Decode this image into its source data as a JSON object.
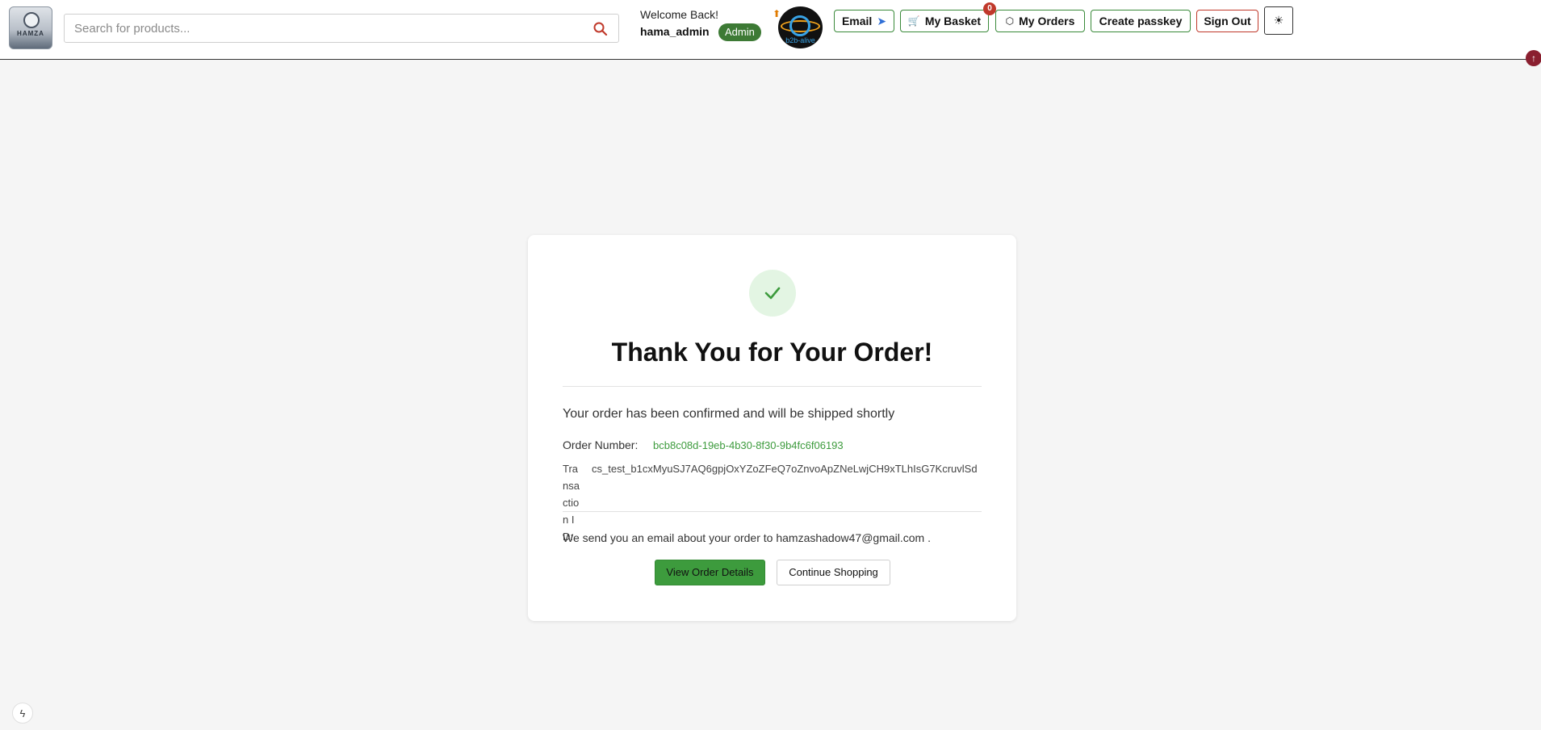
{
  "header": {
    "logo_text": "HAMZA",
    "search_placeholder": "Search for products...",
    "welcome": "Welcome Back!",
    "username": "hama_admin",
    "role": "Admin",
    "brand_text": "b2b-alive",
    "nav": {
      "email": "Email",
      "basket": "My Basket",
      "basket_count": "0",
      "orders": "My Orders",
      "passkey": "Create passkey",
      "signout": "Sign Out"
    }
  },
  "confirmation": {
    "title": "Thank You for Your Order!",
    "message": "Your order has been confirmed and will be shipped shortly",
    "order_number_label": "Order Number:",
    "order_number": "bcb8c08d-19eb-4b30-8f30-9b4fc6f06193",
    "transaction_label": "Transaction ID:",
    "transaction_value": "cs_test_b1cxMyuSJ7AQ6gpjOxYZoZFeQ7oZnvoApZNeLwjCH9xTLhIsG7KcruvlSd",
    "email_prefix": "We send you an email about your order to",
    "email": "hamzashadow47@gmail.com",
    "email_suffix": ".",
    "view_details": "View Order Details",
    "continue": "Continue Shopping"
  },
  "icons": {
    "search": "search-icon",
    "send": "send-icon",
    "cart": "cart-icon",
    "box": "box-icon",
    "theme": "sun-icon",
    "scroll_top": "arrow-up-icon",
    "check": "check-icon",
    "bolt": "bolt-icon"
  },
  "colors": {
    "accent_green": "#3d9b3d",
    "badge_green": "#3d7a35",
    "danger": "#c0392b",
    "background": "#f5f5f5"
  }
}
